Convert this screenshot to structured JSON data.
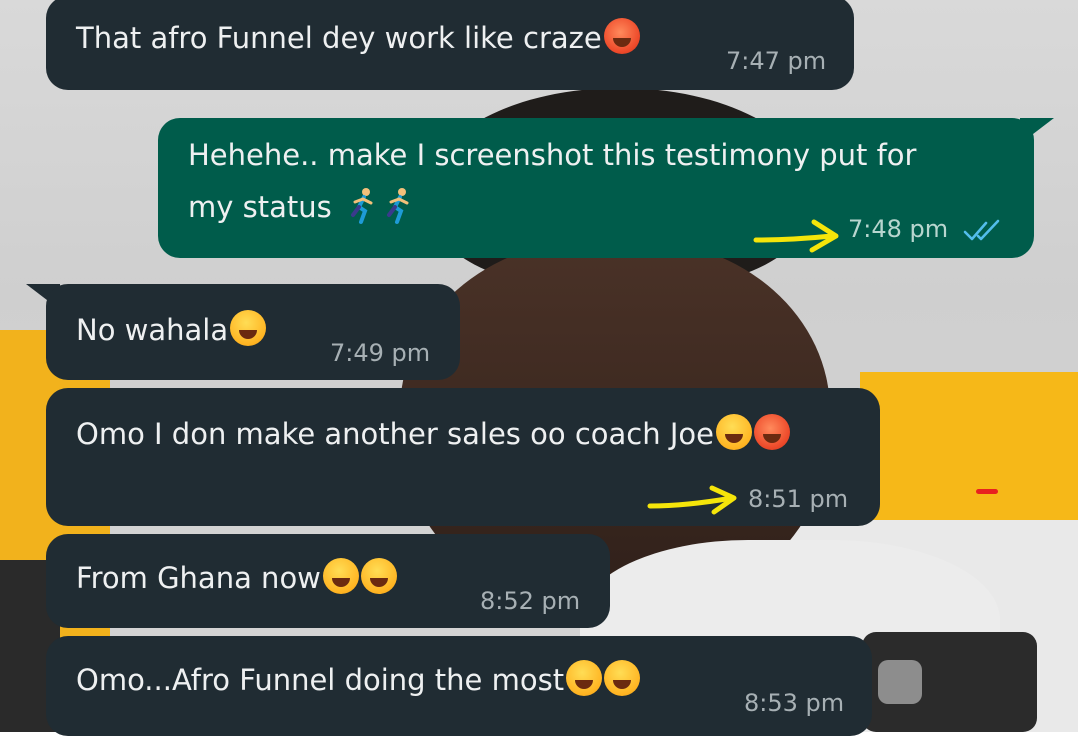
{
  "messages": [
    {
      "side": "incoming",
      "text": "That afro Funnel dey work like craze",
      "emojis": [
        "hot-face"
      ],
      "time": "7:47 pm"
    },
    {
      "side": "outgoing",
      "line1": "Hehehe.. make I screenshot this testimony put for",
      "line2": "my status",
      "emojis": [
        "person-running",
        "person-running"
      ],
      "time": "7:48 pm",
      "status": "read-double-tick"
    },
    {
      "side": "incoming",
      "text": "No wahala",
      "emojis": [
        "grinning-sweat"
      ],
      "time": "7:49 pm"
    },
    {
      "side": "incoming",
      "text": "Omo I don make another sales oo coach Joe",
      "emojis": [
        "tears-of-joy",
        "hot-face"
      ],
      "time": "8:51 pm"
    },
    {
      "side": "incoming",
      "text": "From Ghana now",
      "emojis": [
        "tears-of-joy",
        "rolling-laughing"
      ],
      "time": "8:52 pm"
    },
    {
      "side": "incoming",
      "text": "Omo...Afro Funnel doing the most",
      "emojis": [
        "grinning-sweat",
        "grinning-sweat"
      ],
      "time": "8:53 pm"
    }
  ],
  "colors": {
    "incoming_bubble": "#202c33",
    "outgoing_bubble": "#005c4b",
    "annotation_arrow": "#f5e50a",
    "read_tick": "#53bdeb"
  }
}
